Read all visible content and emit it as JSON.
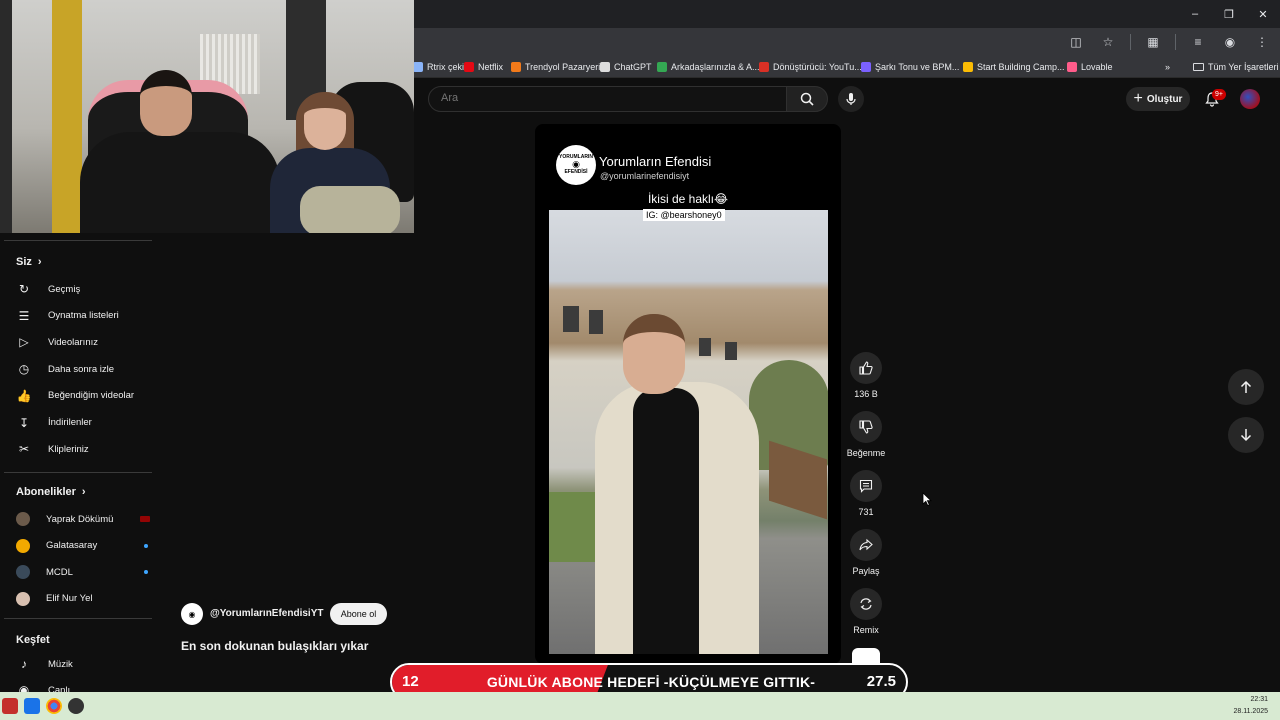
{
  "browser": {
    "bookmarks": [
      {
        "label": "Rtrix çekiliş",
        "icon": "bookmark-icon",
        "color": "#8ab4f8"
      },
      {
        "label": "Netflix",
        "icon": "netflix-icon",
        "color": "#e50914"
      },
      {
        "label": "Trendyol Pazaryeri",
        "icon": "trendyol-icon",
        "color": "#f27a1a"
      },
      {
        "label": "ChatGPT",
        "icon": "chatgpt-icon",
        "color": "#dddddd"
      },
      {
        "label": "Arkadaşlarınızla & A...",
        "icon": "green-person-icon",
        "color": "#34a853"
      },
      {
        "label": "Dönüştürücü: YouTu...",
        "icon": "converter-icon",
        "color": "#d93025"
      },
      {
        "label": "Şarkı Tonu ve BPM...",
        "icon": "music-v-icon",
        "color": "#7b61ff"
      },
      {
        "label": "Start Building Camp...",
        "icon": "chrome-icon",
        "color": "#fbbc04"
      },
      {
        "label": "Lovable",
        "icon": "lovable-icon",
        "color": "#ff5c8a"
      }
    ],
    "all_bookmarks": "Tüm Yer İşaretleri",
    "more_bookmarks": "»"
  },
  "header": {
    "search_placeholder": "Ara",
    "create_label": "Oluştur",
    "notification_count": "9+"
  },
  "sidebar": {
    "you_heading": "Siz",
    "you_items": [
      {
        "label": "Geçmiş",
        "icon": "history-icon"
      },
      {
        "label": "Oynatma listeleri",
        "icon": "playlists-icon"
      },
      {
        "label": "Videolarınız",
        "icon": "your-videos-icon"
      },
      {
        "label": "Daha sonra izle",
        "icon": "watch-later-icon"
      },
      {
        "label": "Beğendiğim videolar",
        "icon": "liked-videos-icon"
      },
      {
        "label": "İndirilenler",
        "icon": "downloads-icon"
      },
      {
        "label": "Klipleriniz",
        "icon": "clips-icon"
      }
    ],
    "subs_heading": "Abonelikler",
    "subs_items": [
      {
        "label": "Yaprak Dökümü",
        "color": "#6b5a4a",
        "indicator": "live"
      },
      {
        "label": "Galatasaray",
        "color": "#f2a900",
        "indicator": "dot"
      },
      {
        "label": "MCDL",
        "color": "#3a4a5a",
        "indicator": "dot"
      },
      {
        "label": "Elif Nur Yel",
        "color": "#d8c0b0",
        "indicator": "none"
      }
    ],
    "explore_heading": "Keşfet",
    "explore_items": [
      {
        "label": "Müzik",
        "icon": "music-icon"
      },
      {
        "label": "Canlı",
        "icon": "live-icon"
      }
    ]
  },
  "short": {
    "channel_logo_text": [
      "YORUMLARIN",
      "EFENDİSİ"
    ],
    "channel_name": "Yorumların Efendisi",
    "channel_handle": "@yorumlarinefendisiyt",
    "caption": "İkisi de haklı😂",
    "ig_tag": "IG: @bearshoney0",
    "meta_handle": "@YorumlarınEfendisiYT",
    "subscribe_label": "Abone ol",
    "title": "En son dokunan bulaşıkları yıkar"
  },
  "actions": {
    "like_count": "136 B",
    "dislike_label": "Beğenme",
    "comment_count": "731",
    "share_label": "Paylaş",
    "remix_label": "Remix"
  },
  "goal_banner": {
    "start": "12",
    "text": "GÜNLÜK ABONE HEDEFİ -KÜÇÜLMEYE GITTIK-",
    "end": "27.5",
    "progress": 0.42,
    "fill_color": "#e11d2a"
  },
  "taskbar": {
    "time": "22:31",
    "date": "28.11.2025"
  }
}
